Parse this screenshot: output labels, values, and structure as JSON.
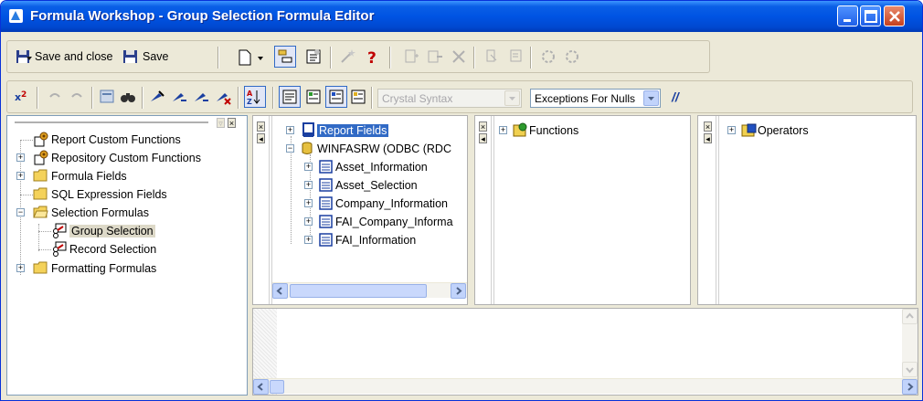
{
  "window": {
    "title": "Formula Workshop - Group Selection Formula Editor"
  },
  "toolbar1": {
    "save_close_label": "Save and close",
    "save_label": "Save"
  },
  "toolbar2": {
    "syntax_select": "Crystal Syntax",
    "nulls_select": "Exceptions For Nulls",
    "comment_label": "//"
  },
  "workshop_tree": {
    "items": [
      {
        "label": "Report Custom Functions",
        "icon": "custom-function-icon"
      },
      {
        "label": "Repository Custom Functions",
        "icon": "custom-function-icon"
      },
      {
        "label": "Formula Fields",
        "icon": "folder-icon"
      },
      {
        "label": "SQL Expression Fields",
        "icon": "folder-icon"
      },
      {
        "label": "Selection Formulas",
        "icon": "folder-open-icon"
      },
      {
        "label": "Group Selection",
        "icon": "selection-formula-icon"
      },
      {
        "label": "Record Selection",
        "icon": "selection-formula-icon"
      },
      {
        "label": "Formatting Formulas",
        "icon": "folder-icon"
      }
    ]
  },
  "fields_tree": {
    "root": "Report Fields",
    "db": "WINFASRW (ODBC (RDC",
    "tables": [
      "Asset_Information",
      "Asset_Selection",
      "Company_Information",
      "FAI_Company_Informa",
      "FAI_Information"
    ]
  },
  "functions_tree": {
    "root": "Functions"
  },
  "operators_tree": {
    "root": "Operators"
  },
  "colors": {
    "titlebar": "#0054e3",
    "selection_highlight": "#316ac5",
    "window_face": "#ece9d8"
  }
}
